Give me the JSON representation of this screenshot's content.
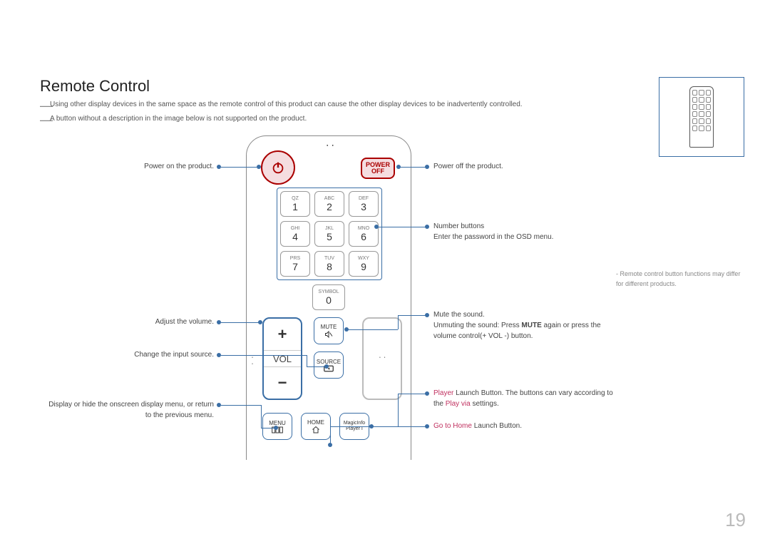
{
  "title": "Remote Control",
  "notes": {
    "n1": "Using other display devices in the same space as the remote control of this product can cause the other display devices to be inadvertently controlled.",
    "n2": "A button without a description in the image below is not supported on the product."
  },
  "labelsLeft": {
    "power": "Power on the product.",
    "vol": "Adjust the volume.",
    "source": "Change the input source.",
    "menu": "Display or hide the onscreen display menu, or return to the previous menu."
  },
  "labelsRight": {
    "poweroff": "Power off the product.",
    "numbers1": "Number buttons",
    "numbers2": "Enter the password in the OSD menu.",
    "mute1": "Mute the sound.",
    "mute2a": "Unmuting the sound: Press ",
    "mute2b": "MUTE",
    "mute2c": " again or press the volume control(+ VOL -) button.",
    "player1a": "Player",
    "player1b": " Launch Button. The buttons can vary according to the ",
    "player1c": "Play via",
    "player1d": " settings.",
    "home1": "Go to Home",
    "home2": " Launch Button."
  },
  "buttons": {
    "powerOff": {
      "l1": "POWER",
      "l2": "OFF"
    },
    "num": [
      {
        "t": "QZ",
        "n": "1"
      },
      {
        "t": "ABC",
        "n": "2"
      },
      {
        "t": "DEF",
        "n": "3"
      },
      {
        "t": "GHI",
        "n": "4"
      },
      {
        "t": "JKL",
        "n": "5"
      },
      {
        "t": "MNO",
        "n": "6"
      },
      {
        "t": "PRS",
        "n": "7"
      },
      {
        "t": "TUV",
        "n": "8"
      },
      {
        "t": "WXY",
        "n": "9"
      }
    ],
    "zero": {
      "t": "SYMBOL",
      "n": "0"
    },
    "vol": {
      "plus": "+",
      "label": "VOL",
      "minus": "−"
    },
    "mute": "MUTE",
    "source": "SOURCE",
    "menu": "MENU",
    "home": "HOME",
    "magic1": "MagicInfo",
    "magic2": "Player I"
  },
  "sidenote": "Remote control button functions may differ for different products.",
  "pageNumber": "19"
}
